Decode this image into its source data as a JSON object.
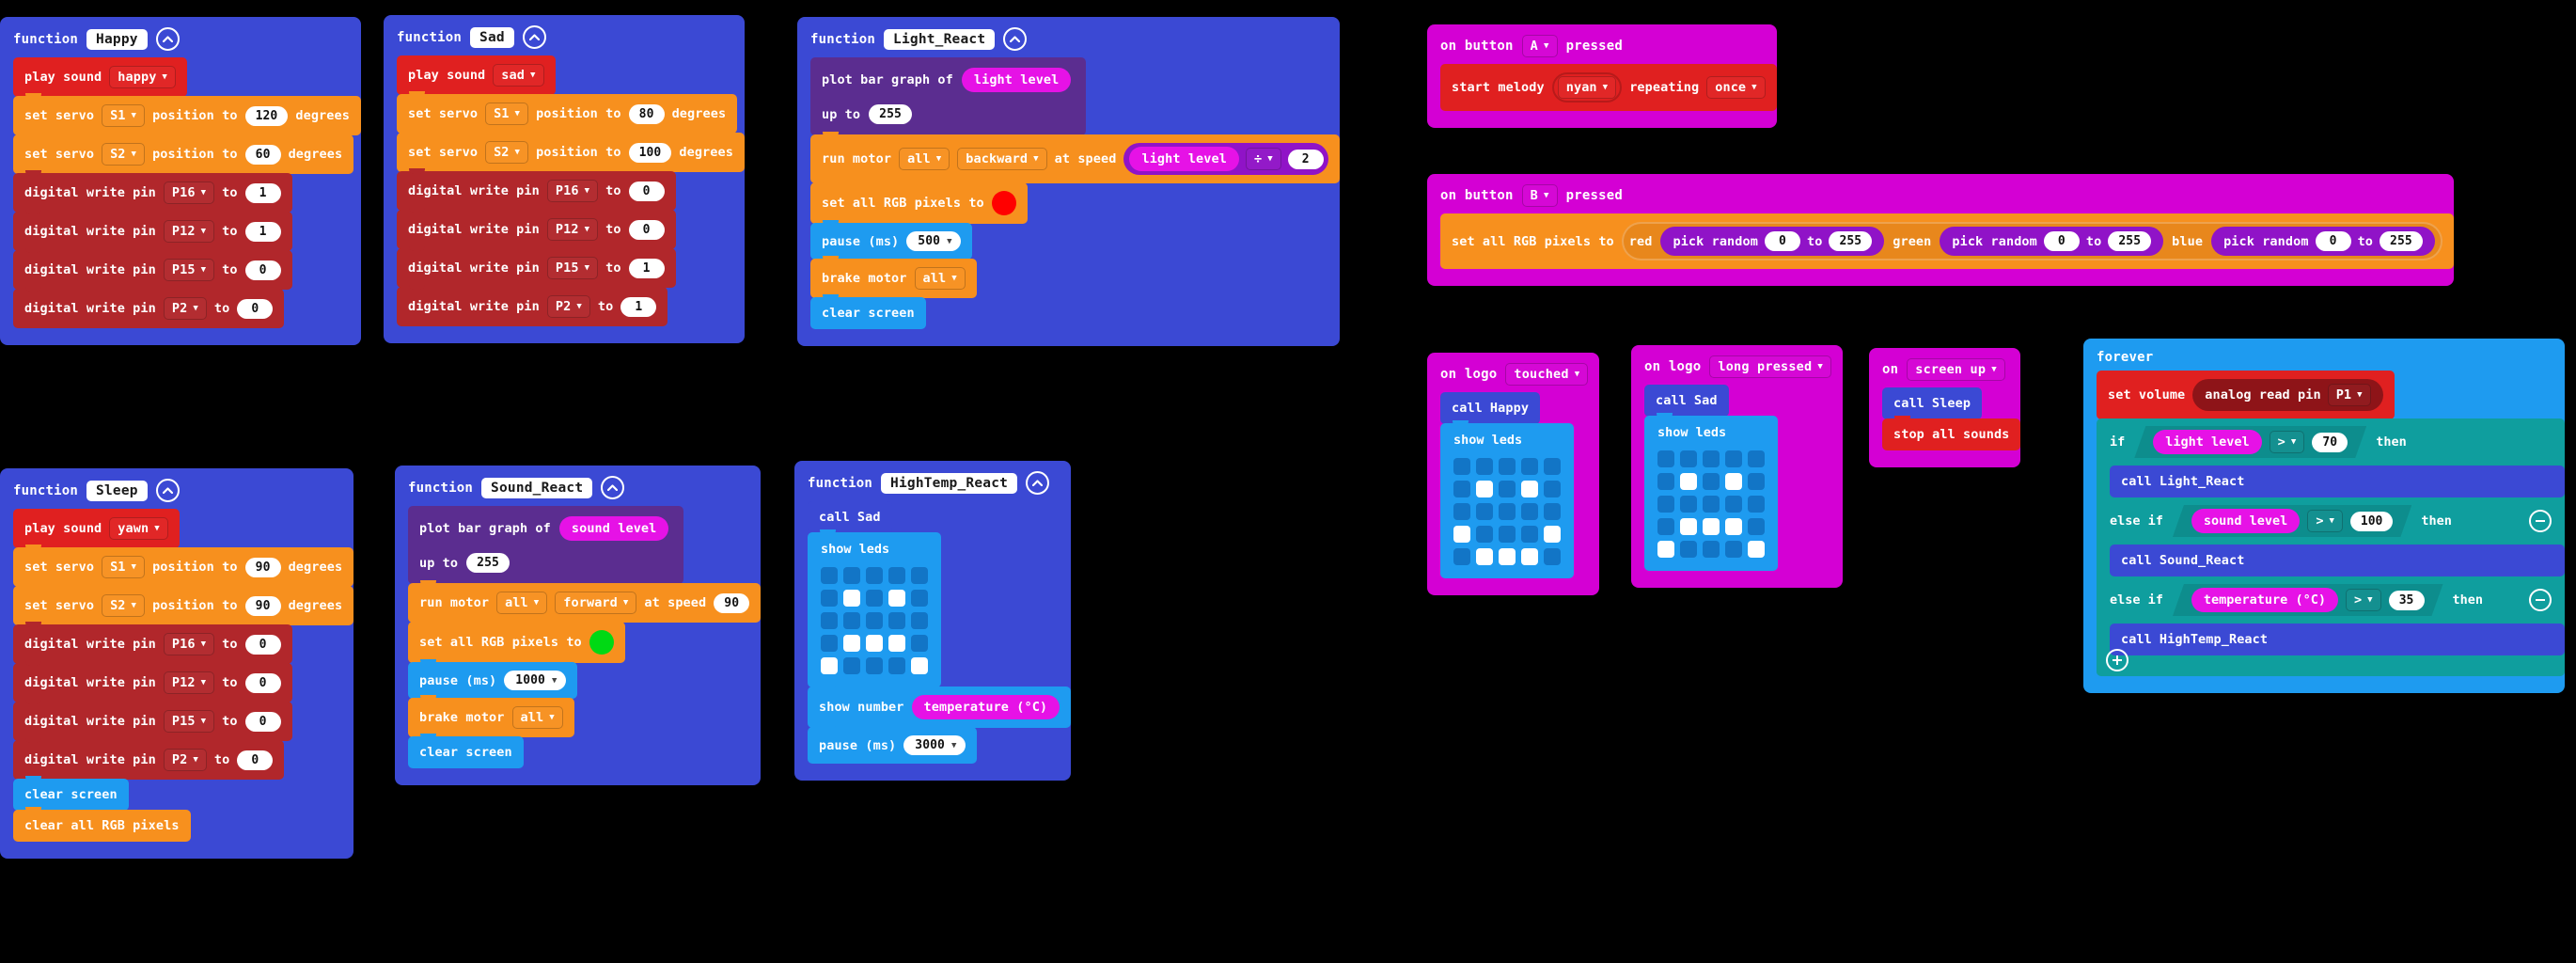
{
  "app": {
    "name": "MakeCode Blocks Workspace",
    "background": "#000000"
  },
  "palette": {
    "function": "#3b49d4",
    "event": "#d400d4",
    "loop": "#1e9bf0",
    "music": "#e02020",
    "pins": "#b1272b",
    "servo_motor": "#f7901e",
    "led_display": "#1e9bf0",
    "plot": "#5b2d90",
    "sensor": "#e612e6",
    "math": "#9013c7",
    "logic": "#0f9e9e",
    "rgb_red": "#ff0000",
    "rgb_green": "#00d914"
  },
  "labels": {
    "function": "function",
    "play_sound": "play sound",
    "set_servo": "set servo",
    "position_to": "position to",
    "degrees": "degrees",
    "digital_write_pin": "digital write pin",
    "to": "to",
    "plot_bar_graph_of": "plot bar graph of",
    "up_to": "up to",
    "run_motor": "run motor",
    "at_speed": "at speed",
    "set_all_rgb": "set all RGB pixels to",
    "clear_all_rgb": "clear all RGB pixels",
    "pause_ms": "pause (ms)",
    "brake_motor": "brake motor",
    "clear_screen": "clear screen",
    "show_leds": "show leds",
    "show_number": "show number",
    "on_button": "on button",
    "pressed": "pressed",
    "start_melody": "start melody",
    "repeating": "repeating",
    "on_logo": "on logo",
    "on": "on",
    "stop_all_sounds": "stop all sounds",
    "forever": "forever",
    "set_volume": "set volume",
    "analog_read_pin": "analog read pin",
    "if": "if",
    "else_if": "else if",
    "then": "then",
    "red": "red",
    "green": "green",
    "blue": "blue",
    "pick_random": "pick random",
    "call_prefix": "call"
  },
  "functions": [
    {
      "name": "Happy",
      "blocks": [
        {
          "type": "play_sound",
          "sound": "happy"
        },
        {
          "type": "set_servo",
          "servo": "S1",
          "degrees": "120"
        },
        {
          "type": "set_servo",
          "servo": "S2",
          "degrees": "60"
        },
        {
          "type": "digital_write",
          "pin": "P16",
          "value": "1"
        },
        {
          "type": "digital_write",
          "pin": "P12",
          "value": "1"
        },
        {
          "type": "digital_write",
          "pin": "P15",
          "value": "0"
        },
        {
          "type": "digital_write",
          "pin": "P2",
          "value": "0"
        }
      ]
    },
    {
      "name": "Sad",
      "blocks": [
        {
          "type": "play_sound",
          "sound": "sad"
        },
        {
          "type": "set_servo",
          "servo": "S1",
          "degrees": "80"
        },
        {
          "type": "set_servo",
          "servo": "S2",
          "degrees": "100"
        },
        {
          "type": "digital_write",
          "pin": "P16",
          "value": "0"
        },
        {
          "type": "digital_write",
          "pin": "P12",
          "value": "0"
        },
        {
          "type": "digital_write",
          "pin": "P15",
          "value": "1"
        },
        {
          "type": "digital_write",
          "pin": "P2",
          "value": "1"
        }
      ]
    },
    {
      "name": "Light_React",
      "blocks": [
        {
          "type": "plot_bar",
          "sensor": "light level",
          "upto": "255"
        },
        {
          "type": "run_motor",
          "motor": "all",
          "direction": "backward",
          "speed_sensor": "light level",
          "speed_op": "÷",
          "speed_operand": "2"
        },
        {
          "type": "set_rgb",
          "color": "#ff0000"
        },
        {
          "type": "pause",
          "ms": "500"
        },
        {
          "type": "brake_motor",
          "motor": "all"
        },
        {
          "type": "clear_screen"
        }
      ]
    },
    {
      "name": "Sleep",
      "blocks": [
        {
          "type": "play_sound",
          "sound": "yawn"
        },
        {
          "type": "set_servo",
          "servo": "S1",
          "degrees": "90"
        },
        {
          "type": "set_servo",
          "servo": "S2",
          "degrees": "90"
        },
        {
          "type": "digital_write",
          "pin": "P16",
          "value": "0"
        },
        {
          "type": "digital_write",
          "pin": "P12",
          "value": "0"
        },
        {
          "type": "digital_write",
          "pin": "P15",
          "value": "0"
        },
        {
          "type": "digital_write",
          "pin": "P2",
          "value": "0"
        },
        {
          "type": "clear_screen"
        },
        {
          "type": "clear_all_rgb"
        }
      ]
    },
    {
      "name": "Sound_React",
      "blocks": [
        {
          "type": "plot_bar",
          "sensor": "sound level",
          "upto": "255"
        },
        {
          "type": "run_motor",
          "motor": "all",
          "direction": "forward",
          "speed": "90"
        },
        {
          "type": "set_rgb",
          "color": "#00d914"
        },
        {
          "type": "pause",
          "ms": "1000"
        },
        {
          "type": "brake_motor",
          "motor": "all"
        },
        {
          "type": "clear_screen"
        }
      ]
    },
    {
      "name": "HighTemp_React",
      "blocks": [
        {
          "type": "call",
          "target": "Sad"
        },
        {
          "type": "show_leds",
          "pattern": [
            [
              0,
              0,
              0,
              0,
              0
            ],
            [
              0,
              1,
              0,
              1,
              0
            ],
            [
              0,
              0,
              0,
              0,
              0
            ],
            [
              0,
              1,
              1,
              1,
              0
            ],
            [
              1,
              0,
              0,
              0,
              1
            ]
          ]
        },
        {
          "type": "show_number",
          "value": "temperature (°C)"
        },
        {
          "type": "pause",
          "ms": "3000"
        }
      ]
    }
  ],
  "events": [
    {
      "id": "on-button-a",
      "header": {
        "label": "on button",
        "option": "A",
        "suffix": "pressed"
      },
      "blocks": [
        {
          "type": "start_melody",
          "melody": "nyan",
          "repeating": "once"
        }
      ]
    },
    {
      "id": "on-button-b",
      "header": {
        "label": "on button",
        "option": "B",
        "suffix": "pressed"
      },
      "blocks": [
        {
          "type": "set_rgb_random",
          "red": {
            "from": "0",
            "to": "255"
          },
          "green": {
            "from": "0",
            "to": "255"
          },
          "blue": {
            "from": "0",
            "to": "255"
          }
        }
      ]
    },
    {
      "id": "on-logo-touched",
      "header": {
        "label": "on logo",
        "option": "touched",
        "suffix": ""
      },
      "blocks": [
        {
          "type": "call",
          "target": "Happy"
        },
        {
          "type": "show_leds",
          "pattern": [
            [
              0,
              0,
              0,
              0,
              0
            ],
            [
              0,
              1,
              0,
              1,
              0
            ],
            [
              0,
              0,
              0,
              0,
              0
            ],
            [
              1,
              0,
              0,
              0,
              1
            ],
            [
              0,
              1,
              1,
              1,
              0
            ]
          ]
        }
      ]
    },
    {
      "id": "on-logo-long-pressed",
      "header": {
        "label": "on logo",
        "option": "long pressed",
        "suffix": ""
      },
      "blocks": [
        {
          "type": "call",
          "target": "Sad"
        },
        {
          "type": "show_leds",
          "pattern": [
            [
              0,
              0,
              0,
              0,
              0
            ],
            [
              0,
              1,
              0,
              1,
              0
            ],
            [
              0,
              0,
              0,
              0,
              0
            ],
            [
              0,
              1,
              1,
              1,
              0
            ],
            [
              1,
              0,
              0,
              0,
              1
            ]
          ]
        }
      ]
    },
    {
      "id": "on-screen-up",
      "header": {
        "label": "on",
        "option": "screen up",
        "suffix": ""
      },
      "blocks": [
        {
          "type": "call",
          "target": "Sleep"
        },
        {
          "type": "stop_all_sounds"
        }
      ]
    }
  ],
  "forever": {
    "label": "forever",
    "set_volume": {
      "label": "set volume",
      "reporter": "analog read pin",
      "pin": "P1"
    },
    "branches": [
      {
        "keyword": "if",
        "sensor": "light level",
        "op": ">",
        "value": "70",
        "call": "Light_React",
        "removable": false
      },
      {
        "keyword": "else if",
        "sensor": "sound level",
        "op": ">",
        "value": "100",
        "call": "Sound_React",
        "removable": true
      },
      {
        "keyword": "else if",
        "sensor": "temperature (°C)",
        "op": ">",
        "value": "35",
        "call": "HighTemp_React",
        "removable": true
      }
    ],
    "then": "then"
  }
}
